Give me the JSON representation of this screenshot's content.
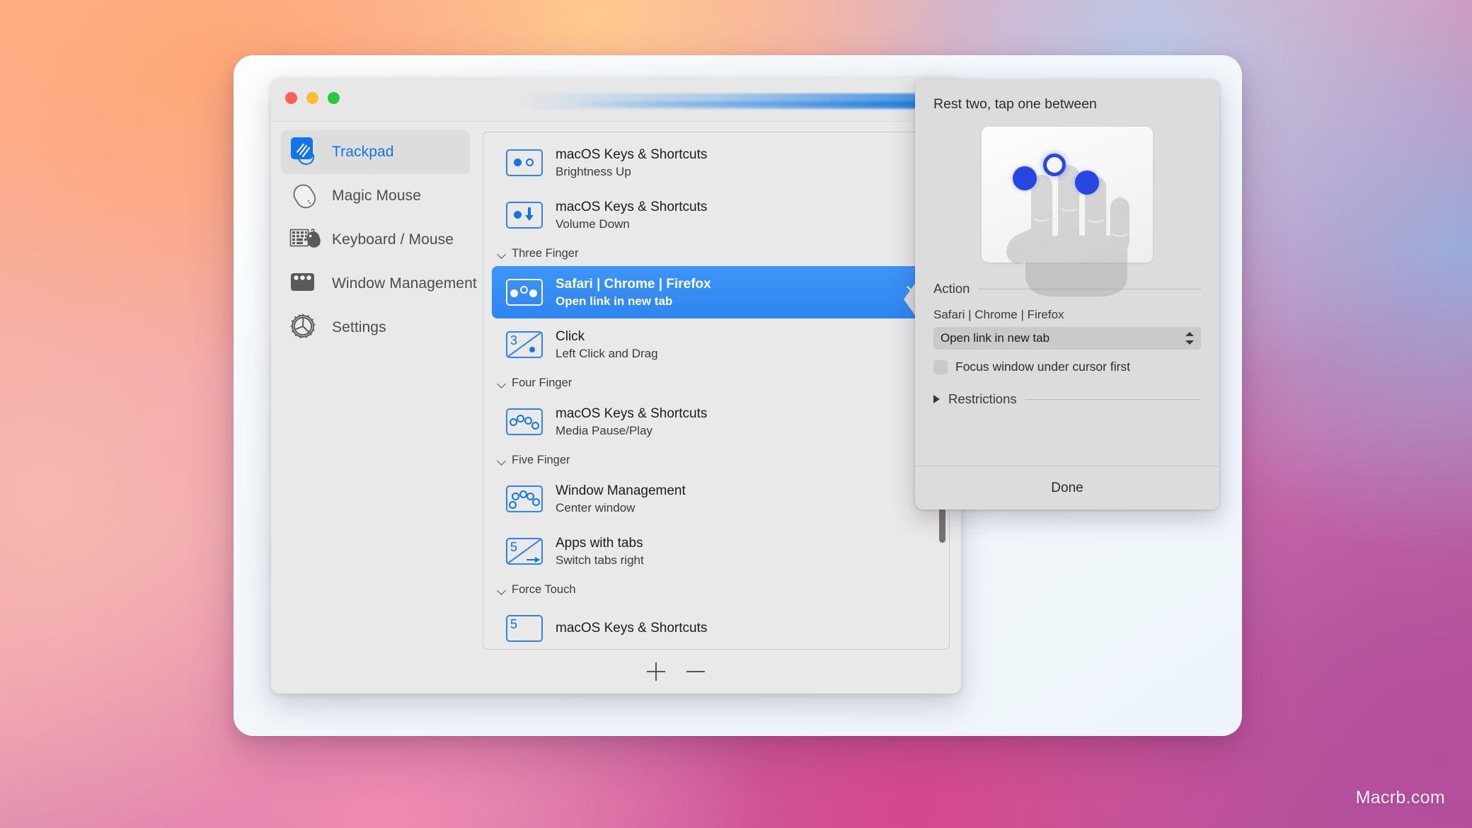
{
  "window": {
    "traffic_lights": [
      {
        "name": "close",
        "color": "#ff5f57"
      },
      {
        "name": "minimize",
        "color": "#febc2e"
      },
      {
        "name": "zoom",
        "color": "#28c840"
      }
    ]
  },
  "sidebar": {
    "items": [
      {
        "label": "Trackpad",
        "icon": "trackpad-hand-icon",
        "selected": true
      },
      {
        "label": "Magic Mouse",
        "icon": "magic-mouse-icon",
        "selected": false
      },
      {
        "label": "Keyboard / Mouse",
        "icon": "keyboard-mouse-icon",
        "selected": false
      },
      {
        "label": "Window Management",
        "icon": "window-bar-icon",
        "selected": false
      },
      {
        "label": "Settings",
        "icon": "gear-icon",
        "selected": false
      }
    ]
  },
  "gesture_list": {
    "rows": [
      {
        "kind": "item",
        "title": "macOS Keys & Shortcuts",
        "subtitle": "Brightness Up",
        "icon": "two-finger-one-tap-icon",
        "selected": false
      },
      {
        "kind": "item",
        "title": "macOS Keys & Shortcuts",
        "subtitle": "Volume Down",
        "icon": "two-finger-down-icon",
        "selected": false
      },
      {
        "kind": "group",
        "title": "Three Finger"
      },
      {
        "kind": "item",
        "title": "Safari | Chrome | Firefox",
        "subtitle": "Open link in new tab",
        "icon": "three-finger-middle-tap-icon",
        "selected": true
      },
      {
        "kind": "item",
        "title": "Click",
        "subtitle": "Left Click and Drag",
        "icon": "three-drag-icon",
        "badge": "3",
        "selected": false
      },
      {
        "kind": "group",
        "title": "Four Finger"
      },
      {
        "kind": "item",
        "title": "macOS Keys & Shortcuts",
        "subtitle": "Media Pause/Play",
        "icon": "four-finger-icon",
        "selected": false
      },
      {
        "kind": "group",
        "title": "Five Finger"
      },
      {
        "kind": "item",
        "title": "Window Management",
        "subtitle": "Center window",
        "icon": "five-finger-icon",
        "selected": false
      },
      {
        "kind": "item",
        "title": "Apps with tabs",
        "subtitle": "Switch tabs right",
        "icon": "five-swipe-right-icon",
        "badge": "5",
        "selected": false
      },
      {
        "kind": "group",
        "title": "Force Touch"
      },
      {
        "kind": "item",
        "title": "macOS Keys & Shortcuts",
        "subtitle": "",
        "icon": "force-touch-icon",
        "badge": "5",
        "selected": false
      }
    ],
    "toolbar": {
      "add_label": "+",
      "remove_label": "−"
    }
  },
  "popover": {
    "heading": "Rest two, tap one between",
    "preview": {
      "dots": [
        {
          "type": "filled",
          "name": "index-finger-dot"
        },
        {
          "type": "ring",
          "name": "middle-finger-tap-dot"
        },
        {
          "type": "filled",
          "name": "ring-finger-dot"
        }
      ]
    },
    "action_section_label": "Action",
    "action_app_label": "Safari | Chrome | Firefox",
    "action_select_value": "Open link in new tab",
    "focus_checkbox_label": "Focus window under cursor first",
    "focus_checkbox_checked": false,
    "restrictions_label": "Restrictions",
    "restrictions_expanded": false,
    "done_label": "Done"
  },
  "watermark": "Macrb.com",
  "colors": {
    "accent_blue": "#2f84f0",
    "link_blue": "#1175e8",
    "dot_blue": "#2747e0",
    "window_bg": "#e9e9e9",
    "popover_bg": "#dcdcdc"
  }
}
